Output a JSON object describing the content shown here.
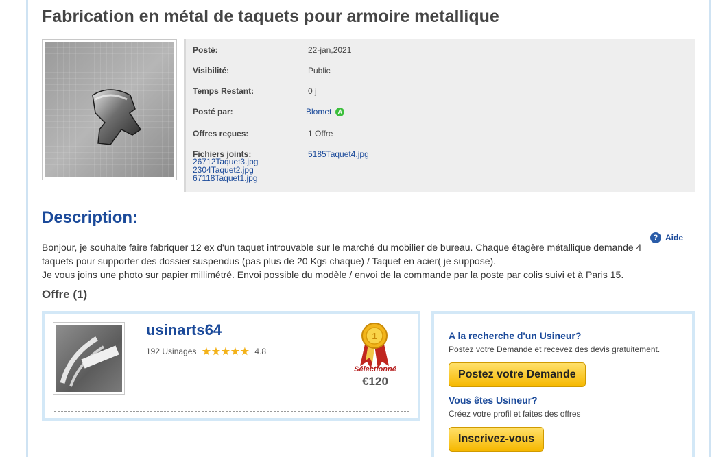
{
  "page": {
    "title": "Fabrication en métal de taquets pour armoire metallique"
  },
  "details": {
    "posted_label": "Posté:",
    "posted_value": "22-jan,2021",
    "visibility_label": "Visibilité:",
    "visibility_value": "Public",
    "time_left_label": "Temps Restant:",
    "time_left_value": "0 j",
    "posted_by_label": "Posté par:",
    "posted_by_value": "Blomet",
    "posted_by_badge": "A",
    "offers_label": "Offres reçues:",
    "offers_value": "1 Offre",
    "files_label": "Fichiers joints:",
    "files_main": "5185Taquet4.jpg",
    "files_list": [
      "26712Taquet3.jpg",
      "2304Taquet2.jpg",
      "67118Taquet1.jpg"
    ]
  },
  "description": {
    "title": "Description:",
    "help_label": "Aide",
    "help_icon": "?",
    "paragraph1": "Bonjour, je souhaite faire fabriquer 12 ex d'un taquet introuvable sur le marché du mobilier de bureau. Chaque étagère métallique demande 4 taquets pour supporter des dossier suspendus (pas plus de 20 Kgs chaque) / Taquet en acier( je suppose).",
    "paragraph2": "Je vous joins une photo sur papier millimétré. Envoi possible du modèle / envoi de la commande par la poste par colis suivi et à Paris 15."
  },
  "offers": {
    "title": "Offre (1)",
    "items": [
      {
        "name": "usinarts64",
        "jobs": "192 Usinages",
        "rating": "4.8",
        "rating_value": 4.8,
        "selected_label": "Sélectionné",
        "price": "€120"
      }
    ]
  },
  "sidebar": {
    "heading1": "A la recherche d'un Usineur?",
    "text1": "Postez votre Demande et recevez des devis gratuitement.",
    "button1": "Postez votre Demande",
    "heading2": "Vous êtes Usineur?",
    "text2": "Créez votre profil et faites des offres",
    "button2": "Inscrivez-vous"
  },
  "colors": {
    "link_blue": "#1b4a9a",
    "frame_blue": "#d3e8f7",
    "button_yellow": "#f6b800",
    "selected_red": "#b51d1d",
    "badge_green": "#3cbf3c"
  }
}
